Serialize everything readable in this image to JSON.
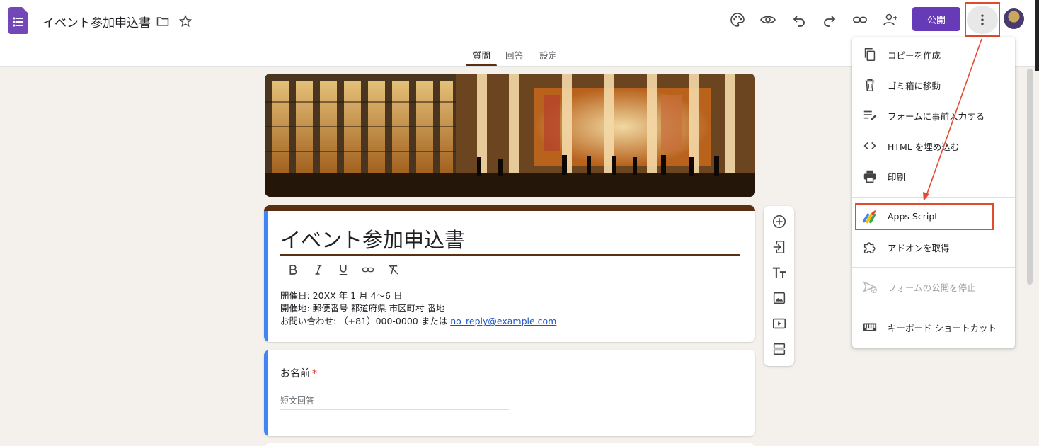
{
  "header": {
    "doc_title": "イベント参加申込書",
    "publish_label": "公開"
  },
  "tabs": [
    {
      "label": "質問",
      "active": true
    },
    {
      "label": "回答",
      "active": false
    },
    {
      "label": "設定",
      "active": false
    }
  ],
  "form": {
    "title": "イベント参加申込書",
    "description": {
      "line1": "開催日: 20XX 年 1 月 4〜6 日",
      "line2": "開催地: 郵便番号 都道府県 市区町村 番地",
      "line3_prefix": "お問い合わせ: （+81）000-0000 または ",
      "line3_link": "no_reply@example.com"
    }
  },
  "question": {
    "label": "お名前",
    "required_mark": "*",
    "placeholder": "短文回答"
  },
  "menu": {
    "items": [
      {
        "label": "コピーを作成",
        "icon": "copy-icon"
      },
      {
        "label": "ゴミ箱に移動",
        "icon": "trash-icon"
      },
      {
        "label": "フォームに事前入力する",
        "icon": "prefill-icon"
      },
      {
        "label": "HTML を埋め込む",
        "icon": "code-icon"
      },
      {
        "label": "印刷",
        "icon": "print-icon"
      },
      {
        "label": "Apps Script",
        "icon": "apps-script-icon"
      },
      {
        "label": "アドオンを取得",
        "icon": "addon-icon"
      },
      {
        "label": "フォームの公開を停止",
        "icon": "unpublish-icon",
        "disabled": true
      },
      {
        "label": "キーボード ショートカット",
        "icon": "keyboard-icon"
      }
    ]
  },
  "colors": {
    "accent": "#673ab7",
    "theme": "#5a2f12",
    "highlight": "#e34b2f",
    "question_strip": "#4285f4"
  }
}
